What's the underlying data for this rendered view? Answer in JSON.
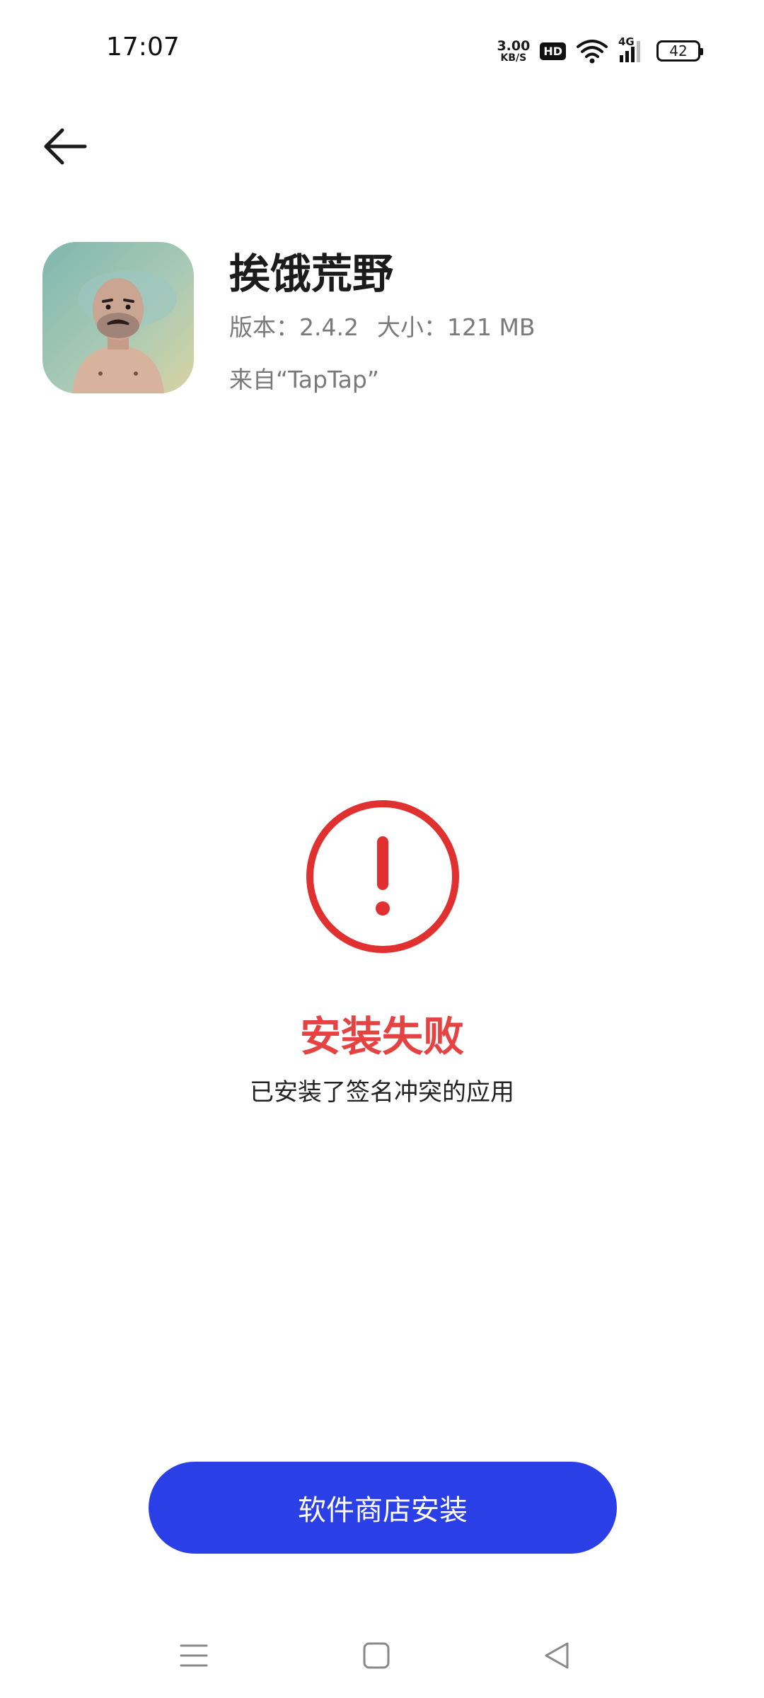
{
  "status_bar": {
    "time": "17:07",
    "net_speed_value": "3.00",
    "net_speed_unit": "KB/S",
    "hd_label": "HD",
    "network_label": "4G",
    "battery_level": "42"
  },
  "app": {
    "name": "挨饿荒野",
    "version_text": "版本：2.4.2",
    "size_text": "大小：121 MB",
    "source_text": "来自“TapTap”"
  },
  "result": {
    "title": "安装失败",
    "description": "已安装了签名冲突的应用",
    "status_color": "#e03030"
  },
  "actions": {
    "store_install_label": "软件商店安装",
    "button_color": "#2b3fe6"
  },
  "nav": {
    "icons": [
      "menu-icon",
      "home-icon",
      "back-triangle-icon"
    ]
  }
}
